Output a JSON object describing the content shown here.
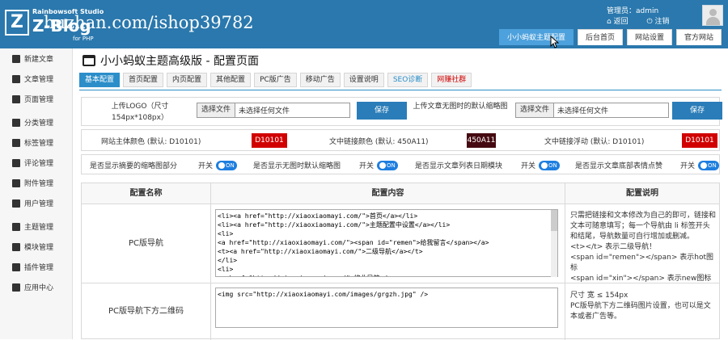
{
  "brand": {
    "top": "Rainbowsoft Studio",
    "name": "Z-Blog",
    "sub": "for PHP",
    "watermark": "huzhan.com/ishop39782"
  },
  "admin": {
    "label": "管理员：admin",
    "back": "返回",
    "logout": "注销"
  },
  "top_tabs": [
    "小小蚂蚁主题配置",
    "后台首页",
    "网站设置",
    "官方网站"
  ],
  "sidebar": [
    "新建文章",
    "文章管理",
    "页面管理",
    "分类管理",
    "标签管理",
    "评论管理",
    "附件管理",
    "用户管理",
    "主题管理",
    "模块管理",
    "插件管理",
    "应用中心"
  ],
  "page": {
    "title": "小小蚂蚁主题高级版 - 配置页面",
    "tabs": [
      "基本配置",
      "首页配置",
      "内页配置",
      "其他配置",
      "PC版广告",
      "移动广告",
      "设置说明",
      "SEO诊断",
      "网赚社群"
    ]
  },
  "upload": {
    "logo_label": "上传LOGO（尺寸154px*108px）",
    "file_button": "选择文件",
    "file_text": "未选择任何文件",
    "save": "保存",
    "thumb_label": "上传文章无图时的默认缩略图"
  },
  "colors": {
    "site_label": "网站主体颜色 (默认: D10101)",
    "site_value": "D10101",
    "site_hex": "#d10101",
    "link_label": "文中链接颜色 (默认: 450A11)",
    "link_value": "450A11",
    "link_hex": "#450a11",
    "hover_label": "文中链接浮动 (默认: D10101)",
    "hover_value": "D10101",
    "hover_hex": "#d10101"
  },
  "toggles": {
    "t1": "是否显示摘要的缩略图部分",
    "t2": "是否显示无图时默认缩略图",
    "t3": "是否显示文章列表日期模块",
    "t4": "是否显示文章底部表情点赞",
    "switch": "开关",
    "on": "ON"
  },
  "table": {
    "headers": [
      "配置名称",
      "配置内容",
      "配置说明"
    ],
    "row1_name": "PC版导航",
    "row1_code": "<li><a href=\"http://xiaoxiaomayi.com/\">首页</a></li>\n<li><a href=\"http://xiaoxiaomayi.com/\">主题配置中设置</a></li>\n<li>\n<a href=\"http://xiaoxiaomayi.com/\"><span id=\"remen\">给我留言</span></a>\n<t><a href=\"http://xiaoxiaomayi.com/\">二级导航</a></t>\n</li>\n<li>\n<a href=\"http://xiaoxiaomayi.com/\">将此导航</a>",
    "row1_desc": "只需把链接和文本修改为自己的即可，链接和文本可随意填写；每一个导航由 li 标签开头和结尾，导航数量可自行增加或删减。\n<t></t> 表示二级导航！\n<span id=\"remen\"></span> 表示hot图标\n<span id=\"xin\"></span> 表示new图标",
    "row2_name": "PC版导航下方二维码",
    "row2_code": "<img src=\"http://xiaoxiaomayi.com/images/grgzh.jpg\" />",
    "row2_desc": "尺寸 宽 ≤ 154px\nPC版导航下方二维码图片设置，也可以是文本或者广告等。"
  }
}
